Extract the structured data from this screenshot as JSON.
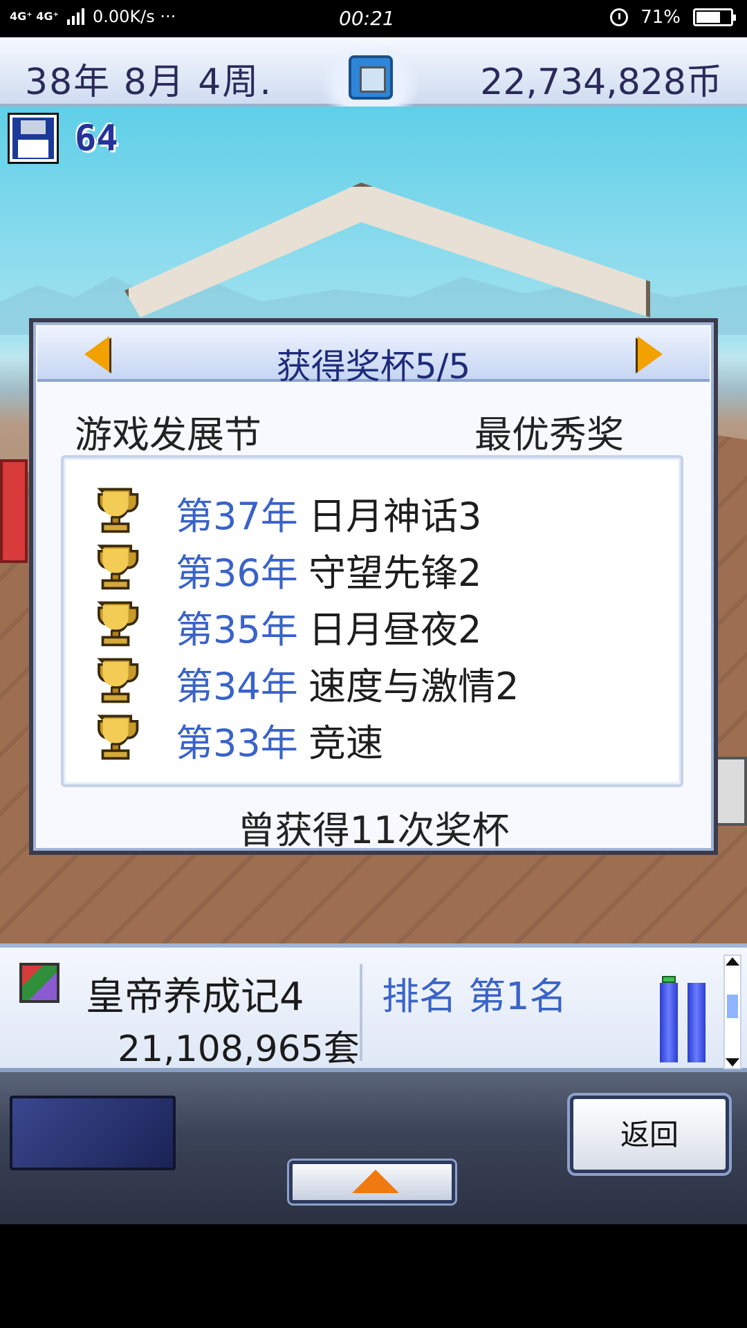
{
  "status_bar": {
    "network": "4G⁺ 4G⁺",
    "speed": "0.00K/s ···",
    "time": "00:21",
    "battery_percent": "71%",
    "battery_level": 0.71
  },
  "top_bar": {
    "date": "38年 8月 4周.",
    "money": "22,734,828币"
  },
  "disk_count": "64",
  "dialog": {
    "title": "获得奖杯5/5",
    "category": "游戏发展节",
    "award": "最优秀奖",
    "trophies": [
      {
        "year": "第37年",
        "game": "日月神话3"
      },
      {
        "year": "第36年",
        "game": "守望先锋2"
      },
      {
        "year": "第35年",
        "game": "日月昼夜2"
      },
      {
        "year": "第34年",
        "game": "速度与激情2"
      },
      {
        "year": "第33年",
        "game": "竞速"
      }
    ],
    "footer": "曾获得11次奖杯"
  },
  "info_panel": {
    "game_name": "皇帝养成记4",
    "sales": "21,108,965套",
    "rank": "排名 第1名",
    "bar_levels": [
      0.82,
      0.82
    ]
  },
  "controls": {
    "back_label": "返回"
  },
  "colors": {
    "accent_blue": "#3a63c9",
    "title_navy": "#1e2b7a",
    "arrow_orange": "#f2a100"
  }
}
